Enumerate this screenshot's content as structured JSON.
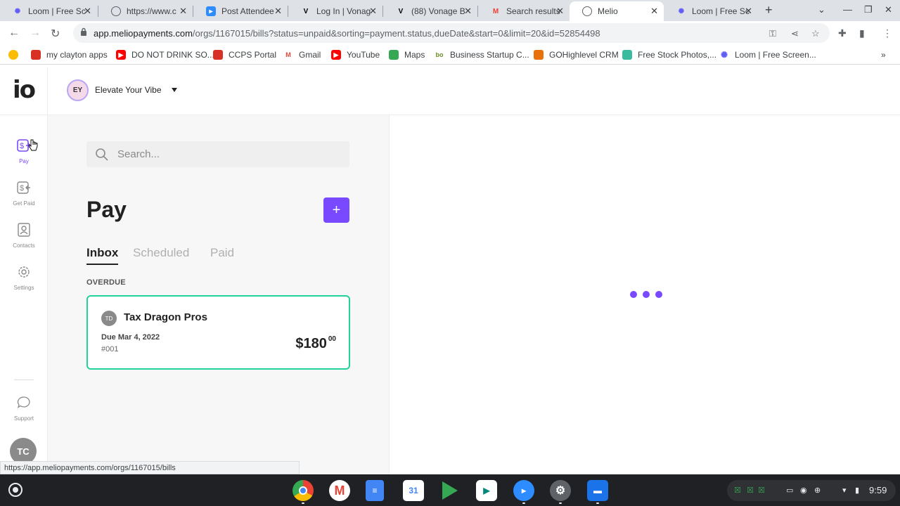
{
  "browser": {
    "tabs": [
      {
        "title": "Loom | Free Sc",
        "icon": "loom-icon"
      },
      {
        "title": "https://www.c",
        "icon": "globe-icon"
      },
      {
        "title": "Post Attendee",
        "icon": "zoom-icon"
      },
      {
        "title": "Log In | Vonag",
        "icon": "vonage-icon"
      },
      {
        "title": "(88) Vonage B",
        "icon": "vonage-icon"
      },
      {
        "title": "Search results",
        "icon": "gmail-icon"
      },
      {
        "title": "Melio",
        "icon": "globe-icon"
      },
      {
        "title": "Loom | Free Sc",
        "icon": "loom-icon"
      }
    ],
    "url_host": "app.meliopayments.com",
    "url_path": "/orgs/1167015/bills?status=unpaid&sorting=payment.status,dueDate&start=0&limit=20&id=52854498",
    "bookmarks": [
      {
        "label": "my clayton apps",
        "color": "#d93025"
      },
      {
        "label": "DO NOT DRINK SO...",
        "color": "#ff0000"
      },
      {
        "label": "CCPS Portal",
        "color": "#d93025"
      },
      {
        "label": "Gmail",
        "color": "#ea4335"
      },
      {
        "label": "YouTube",
        "color": "#ff0000"
      },
      {
        "label": "Maps",
        "color": "#34a853"
      },
      {
        "label": "Business Startup C...",
        "color": "#6b8e23"
      },
      {
        "label": "GOHighlevel CRM",
        "color": "#e8710a"
      },
      {
        "label": "Free Stock Photos,...",
        "color": "#3cba9f"
      },
      {
        "label": "Loom | Free Screen...",
        "color": "#625df5"
      }
    ],
    "status_url": "https://app.meliopayments.com/orgs/1167015/bills"
  },
  "app": {
    "logo": "io",
    "org_initials": "EY",
    "org_name": "Elevate Your Vibe",
    "nav": [
      {
        "label": "Pay",
        "icon": "pay-icon",
        "active": true
      },
      {
        "label": "Get Paid",
        "icon": "get-paid-icon",
        "active": false
      },
      {
        "label": "Contacts",
        "icon": "contacts-icon",
        "active": false
      },
      {
        "label": "Settings",
        "icon": "settings-icon",
        "active": false
      }
    ],
    "support_label": "Support",
    "user_initials": "TC",
    "search_placeholder": "Search...",
    "page_title": "Pay",
    "add_label": "+",
    "tabs": [
      {
        "label": "Inbox",
        "active": true
      },
      {
        "label": "Scheduled",
        "active": false
      },
      {
        "label": "Paid",
        "active": false
      }
    ],
    "section_label": "OVERDUE",
    "bill": {
      "vendor_initials": "TD",
      "vendor_name": "Tax Dragon Pros",
      "due": "Due Mar 4, 2022",
      "invoice": "#001",
      "amount_main": "$180",
      "amount_cents": "00"
    },
    "accent_color": "#7849ff",
    "card_border_color": "#23d19a"
  },
  "shelf": {
    "apps": [
      "Chrome",
      "Gmail",
      "Docs",
      "Calendar",
      "Play Store",
      "Meet",
      "Zoom",
      "Settings",
      "Files"
    ],
    "time": "9:59"
  }
}
